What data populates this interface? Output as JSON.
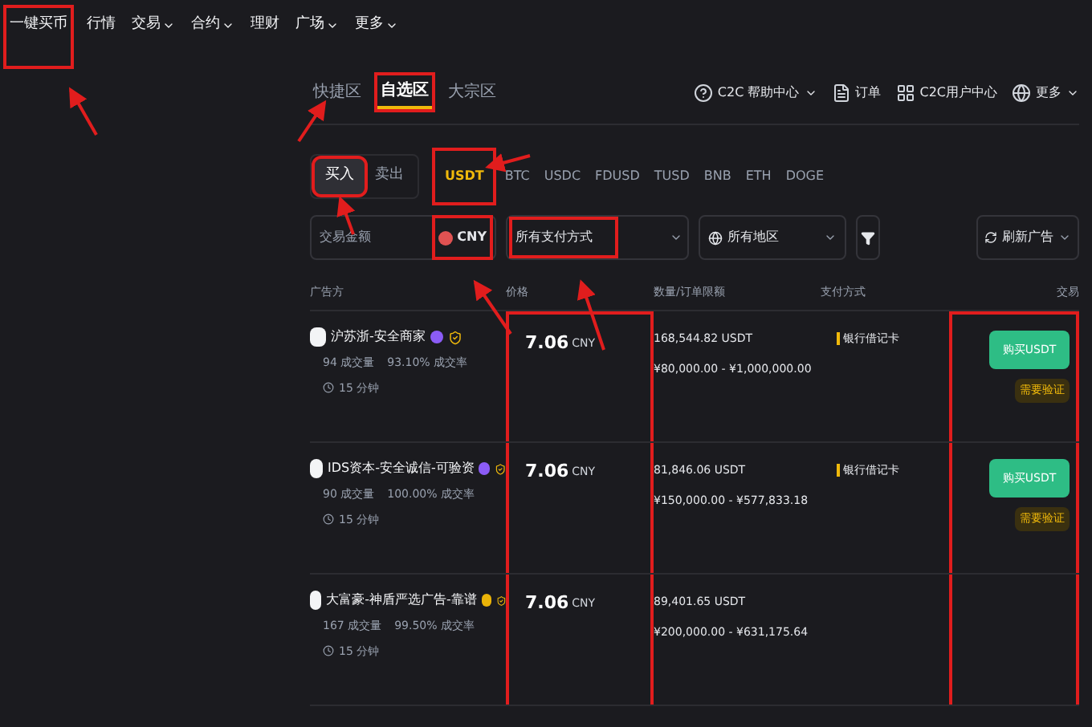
{
  "nav": [
    {
      "label": "一键买币",
      "dropdown": false,
      "highlighted": true
    },
    {
      "label": "行情",
      "dropdown": false,
      "highlighted": false
    },
    {
      "label": "交易",
      "dropdown": true,
      "highlighted": false
    },
    {
      "label": "合约",
      "dropdown": true,
      "highlighted": false
    },
    {
      "label": "理财",
      "dropdown": false,
      "highlighted": false
    },
    {
      "label": "广场",
      "dropdown": true,
      "highlighted": false
    },
    {
      "label": "更多",
      "dropdown": true,
      "highlighted": false
    }
  ],
  "zones": [
    {
      "label": "快捷区",
      "selected": false,
      "highlighted": false
    },
    {
      "label": "自选区",
      "selected": true,
      "highlighted": true
    },
    {
      "label": "大宗区",
      "selected": false,
      "highlighted": false
    }
  ],
  "top_links": [
    {
      "kind": "help",
      "label": "C2C 帮助中心",
      "dropdown": true
    },
    {
      "kind": "orders",
      "label": "订单",
      "dropdown": false
    },
    {
      "kind": "user",
      "label": "C2C用户中心",
      "dropdown": false
    },
    {
      "kind": "more",
      "label": "更多",
      "dropdown": true
    }
  ],
  "sides": [
    {
      "label": "买入",
      "selected": true,
      "highlighted": true
    },
    {
      "label": "卖出",
      "selected": false,
      "highlighted": false
    }
  ],
  "coins": [
    {
      "label": "USDT",
      "selected": true,
      "highlighted": true
    },
    {
      "label": "BTC",
      "selected": false,
      "highlighted": false
    },
    {
      "label": "USDC",
      "selected": false,
      "highlighted": false
    },
    {
      "label": "FDUSD",
      "selected": false,
      "highlighted": false
    },
    {
      "label": "TUSD",
      "selected": false,
      "highlighted": false
    },
    {
      "label": "BNB",
      "selected": false,
      "highlighted": false
    },
    {
      "label": "ETH",
      "selected": false,
      "highlighted": false
    },
    {
      "label": "DOGE",
      "selected": false,
      "highlighted": false
    }
  ],
  "filters": {
    "amount": {
      "placeholder": "交易金额",
      "currency": "CNY",
      "highlighted": true
    },
    "payment": {
      "value": "所有支付方式",
      "highlighted": true
    },
    "region": {
      "value": "所有地区"
    },
    "refresh": "刷新广告"
  },
  "columns": [
    {
      "label": "广告方",
      "highlighted": false
    },
    {
      "label": "价格",
      "highlighted": true
    },
    {
      "label": "数量/订单限额",
      "highlighted": false
    },
    {
      "label": "支付方式",
      "highlighted": false
    },
    {
      "label": "交易",
      "highlighted": true
    }
  ],
  "rows": [
    {
      "advertiser": "沪苏浙-安全商家",
      "color": "#8b5cf6",
      "trades": "94 成交量",
      "rate": "93.10% 成交率",
      "time": "15 分钟",
      "price": "7.06",
      "currency": "CNY",
      "quantity": "168,544.82 USDT",
      "limit": "¥80,000.00 - ¥1,000,000.00",
      "payment": "银行借记卡",
      "action": "购买USDT",
      "note": "需要验证"
    },
    {
      "advertiser": "IDS资本-安全诚信-可验资",
      "color": "#8b5cf6",
      "trades": "90 成交量",
      "rate": "100.00% 成交率",
      "time": "15 分钟",
      "price": "7.06",
      "currency": "CNY",
      "quantity": "81,846.06 USDT",
      "limit": "¥150,000.00 - ¥577,833.18",
      "payment": "银行借记卡",
      "action": "购买USDT",
      "note": "需要验证"
    },
    {
      "advertiser": "大富豪-神盾严选广告-靠谱",
      "color": "#eab308",
      "trades": "167 成交量",
      "rate": "99.50% 成交率",
      "time": "15 分钟",
      "price": "7.06",
      "currency": "CNY",
      "quantity": "89,401.65 USDT",
      "limit": "¥200,000.00 - ¥631,175.64"
    }
  ]
}
